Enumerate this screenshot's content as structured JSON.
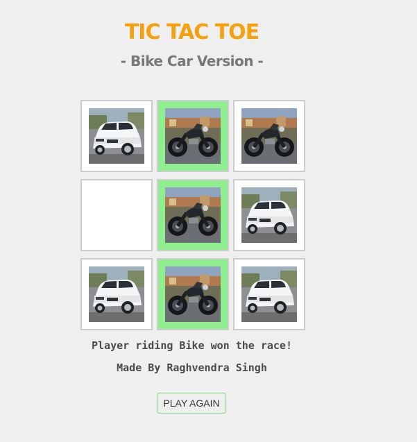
{
  "header": {
    "title": "TIC TAC TOE",
    "subtitle": "- Bike Car Version -"
  },
  "board": {
    "cells": [
      {
        "piece": "car",
        "winning": false
      },
      {
        "piece": "bike",
        "winning": true
      },
      {
        "piece": "bike",
        "winning": false
      },
      {
        "piece": "empty",
        "winning": false
      },
      {
        "piece": "bike",
        "winning": true
      },
      {
        "piece": "car",
        "winning": false
      },
      {
        "piece": "car",
        "winning": false
      },
      {
        "piece": "bike",
        "winning": true
      },
      {
        "piece": "car",
        "winning": false
      }
    ],
    "winning_color": "#90ee90"
  },
  "status_text": "Player riding Bike won the race!",
  "credit_text": "Made By Raghvendra Singh",
  "play_again_label": "PLAY AGAIN",
  "colors": {
    "title": "#f5a00f",
    "subtitle": "#777777",
    "button_border": "#7ed87e"
  }
}
